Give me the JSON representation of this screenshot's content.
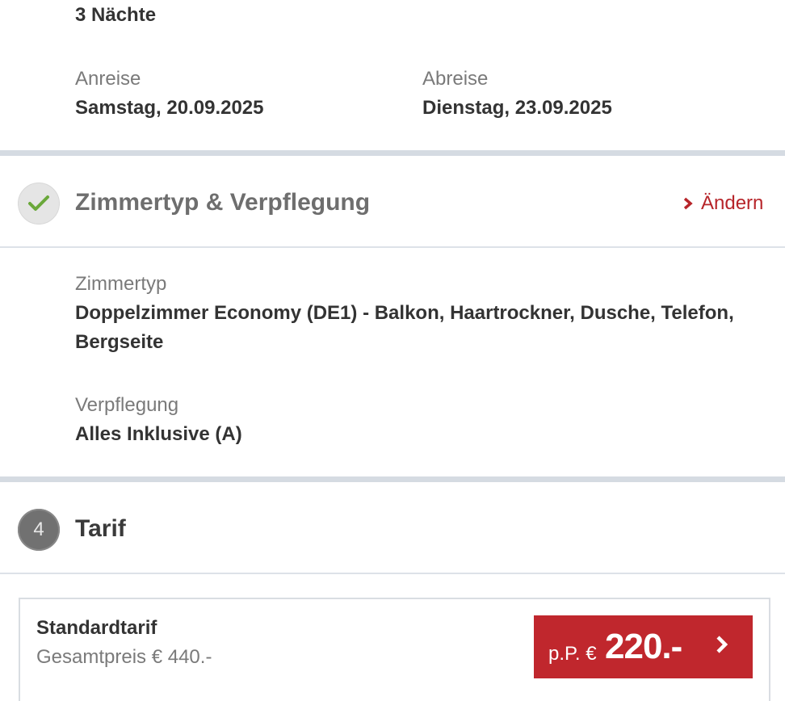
{
  "stay": {
    "nights": "3 Nächte",
    "arrival_label": "Anreise",
    "arrival_date": "Samstag, 20.09.2025",
    "departure_label": "Abreise",
    "departure_date": "Dienstag, 23.09.2025"
  },
  "room_section": {
    "title": "Zimmertyp & Verpflegung",
    "change_label": "Ändern",
    "room_type_label": "Zimmertyp",
    "room_type_line1": "Doppelzimmer Economy (DE1) - Balkon, Haartrockner, Dusche, Telefon,",
    "room_type_line2": "Bergseite",
    "board_label": "Verpflegung",
    "board_value": "Alles Inklusive (A)"
  },
  "tariff_section": {
    "step_number": "4",
    "title": "Tarif",
    "tariff_name": "Standardtarif",
    "total_price": "Gesamtpreis € 440.-",
    "per_person_prefix": "p.P. €",
    "per_person_price": "220.-"
  },
  "colors": {
    "accent_red": "#c0272d",
    "check_green": "#6aa83a",
    "separator": "#d5dbe2"
  },
  "icons": {
    "done_step": "checkmark-icon",
    "change_link": "chevron-right-icon",
    "price_button": "chevron-right-icon"
  }
}
